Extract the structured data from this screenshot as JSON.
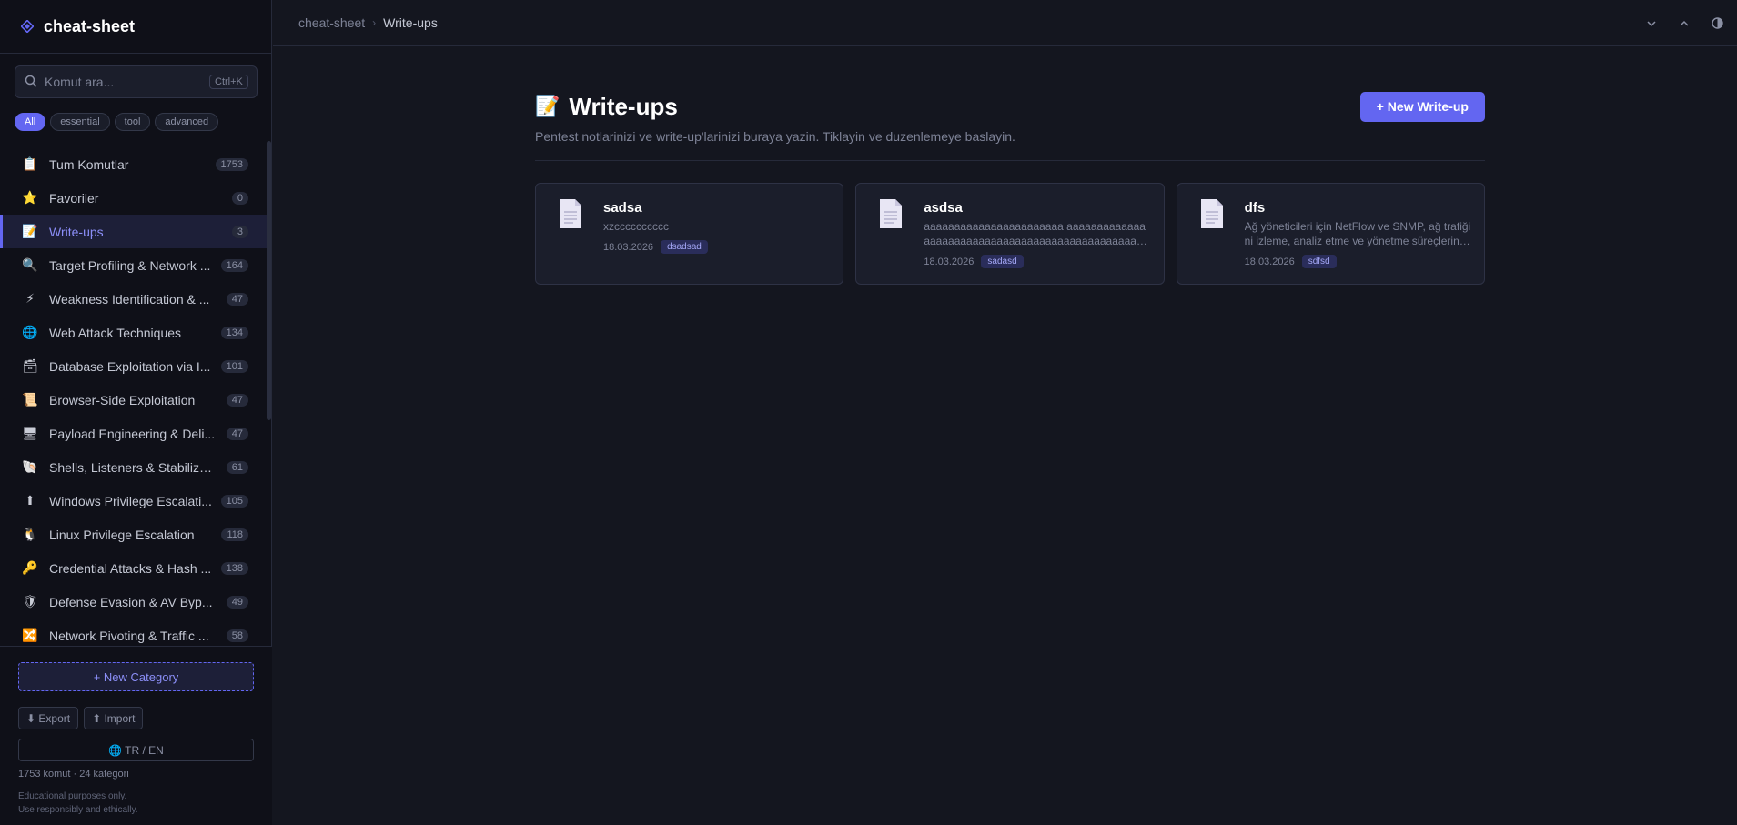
{
  "app": {
    "title": "cheat-sheet",
    "accent": "#6366f1"
  },
  "search": {
    "placeholder": "Komut ara...",
    "value": "",
    "shortcut": "Ctrl+K"
  },
  "filters": [
    {
      "label": "All",
      "active": true
    },
    {
      "label": "essential",
      "active": false
    },
    {
      "label": "tool",
      "active": false
    },
    {
      "label": "advanced",
      "active": false
    }
  ],
  "nav": {
    "items": [
      {
        "icon": "clipboard-icon",
        "glyph": "📋",
        "label": "Tum Komutlar",
        "count": "1753",
        "active": false
      },
      {
        "icon": "star-icon",
        "glyph": "⭐",
        "label": "Favoriler",
        "count": "0",
        "active": false
      },
      {
        "icon": "memo-icon",
        "glyph": "📝",
        "label": "Write-ups",
        "count": "3",
        "active": true
      },
      {
        "icon": "magnifier-icon",
        "glyph": "🔍",
        "label": "Target Profiling & Network ...",
        "count": "164",
        "active": false
      },
      {
        "icon": "lightning-icon",
        "glyph": "⚡",
        "label": "Weakness Identification & ...",
        "count": "47",
        "active": false
      },
      {
        "icon": "globe-icon",
        "glyph": "🌐",
        "label": "Web Attack Techniques",
        "count": "134",
        "active": false
      },
      {
        "icon": "database-icon",
        "glyph": "🗃",
        "label": "Database Exploitation via I...",
        "count": "101",
        "active": false
      },
      {
        "icon": "scroll-icon",
        "glyph": "📜",
        "label": "Browser-Side Exploitation",
        "count": "47",
        "active": false
      },
      {
        "icon": "monitor-icon",
        "glyph": "🖥",
        "label": "Payload Engineering & Deli...",
        "count": "47",
        "active": false
      },
      {
        "icon": "shell-icon",
        "glyph": "🐚",
        "label": "Shells, Listeners & Stabilizat...",
        "count": "61",
        "active": false
      },
      {
        "icon": "up-arrow-icon",
        "glyph": "⬆",
        "label": "Windows Privilege Escalati...",
        "count": "105",
        "active": false
      },
      {
        "icon": "penguin-icon",
        "glyph": "🐧",
        "label": "Linux Privilege Escalation",
        "count": "118",
        "active": false
      },
      {
        "icon": "key-icon",
        "glyph": "🔑",
        "label": "Credential Attacks & Hash ...",
        "count": "138",
        "active": false
      },
      {
        "icon": "shield-icon",
        "glyph": "🛡",
        "label": "Defense Evasion & AV Byp...",
        "count": "49",
        "active": false
      },
      {
        "icon": "shuffle-icon",
        "glyph": "🔀",
        "label": "Network Pivoting & Traffic ...",
        "count": "58",
        "active": false
      }
    ]
  },
  "footer": {
    "new_category": "+ New Category",
    "export": "⬇ Export",
    "import": "⬆ Import",
    "language": "🌐 TR / EN",
    "stats": "1753 komut · 24 kategori",
    "disclaimer_line1": "Educational purposes only.",
    "disclaimer_line2": "Use responsibly and ethically."
  },
  "breadcrumb": {
    "root": "cheat-sheet",
    "separator": "›",
    "current": "Write-ups"
  },
  "main": {
    "title_emoji": "📝",
    "title": "Write-ups",
    "new_button": "+ New Write-up",
    "subtitle": "Pentest notlarinizi ve write-up'larinizi buraya yazin. Tiklayin ve duzenlemeye baslayin.",
    "cards": [
      {
        "title": "sadsa",
        "text": "xzcccccccccc",
        "date": "18.03.2026",
        "tag": "dsadsad"
      },
      {
        "title": "asdsa",
        "text": "aaaaaaaaaaaaaaaaaaaaaaa aaaaaaaaaaaaaaaaaaaaaaaaaaaaaaaaaaaaaaaaaaaaaaaaaaa",
        "date": "18.03.2026",
        "tag": "sadasd"
      },
      {
        "title": "dfs",
        "text": "Ağ yöneticileri için NetFlow ve SNMP, ağ trafiğini izleme, analiz etme ve yönetme süreçlerinde kullanılır.",
        "date": "18.03.2026",
        "tag": "sdfsd"
      }
    ]
  }
}
